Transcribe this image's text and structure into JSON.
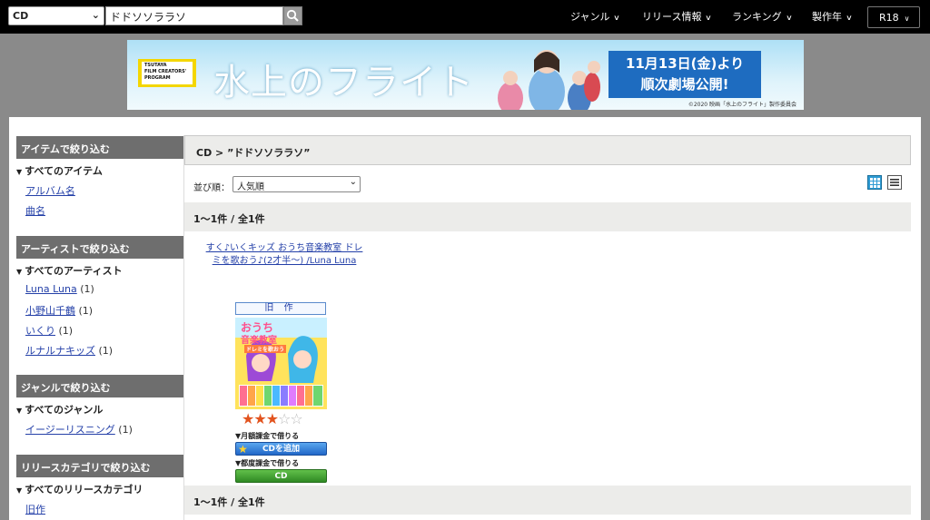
{
  "header": {
    "category": "CD",
    "search_value": "ドドソソララソ",
    "nav": [
      "ジャンル",
      "リリース情報",
      "ランキング",
      "製作年"
    ],
    "r18": "R18"
  },
  "banner": {
    "logo_lines": [
      "TSUTAYA",
      "FILM CREATORS'",
      "PROGRAM"
    ],
    "title": "水上のフライト",
    "date_line1": "11月13日(金)より",
    "date_line2": "順次劇場公開!",
    "copyright": "©2020 映画「水上のフライト」製作委員会"
  },
  "sidebar": {
    "sections": [
      {
        "title": "アイテムで絞り込む",
        "all": "すべてのアイテム",
        "items": [
          {
            "label": "アルバム名",
            "count": ""
          },
          {
            "label": "曲名",
            "count": ""
          }
        ]
      },
      {
        "title": "アーティストで絞り込む",
        "all": "すべてのアーティスト",
        "items": [
          {
            "label": "Luna Luna",
            "count": "(1)"
          },
          {
            "label": "小野山千鶴",
            "count": "(1)"
          },
          {
            "label": "いくり",
            "count": "(1)"
          },
          {
            "label": "ルナルナキッズ",
            "count": "(1)"
          }
        ]
      },
      {
        "title": "ジャンルで絞り込む",
        "all": "すべてのジャンル",
        "items": [
          {
            "label": "イージーリスニング",
            "count": "(1)"
          }
        ]
      },
      {
        "title": "リリースカテゴリで絞り込む",
        "all": "すべてのリリースカテゴリ",
        "items": [
          {
            "label": "旧作",
            "count": ""
          }
        ]
      }
    ]
  },
  "content": {
    "breadcrumb": "CD > ”ドドソソララソ”",
    "sort_label": "並び順：",
    "sort_value": "人気順",
    "count_top": "1～1件 / 全1件",
    "count_bottom": "1～1件 / 全1件",
    "item": {
      "title": "すく♪いくキッズ おうち音楽教室 ドレミを歌おう♪(2才半～) /Luna Luna",
      "badge": "旧 作",
      "rating": 3,
      "rating_max": 5,
      "monthly_label": "▼月額課金で借りる",
      "add_cd_label": "CDを追加",
      "per_label": "▼都度課金で借りる",
      "cd_label": "CD",
      "jacket_text": [
        "おうち",
        "音楽教室",
        "ドレミを歌おう"
      ]
    }
  }
}
